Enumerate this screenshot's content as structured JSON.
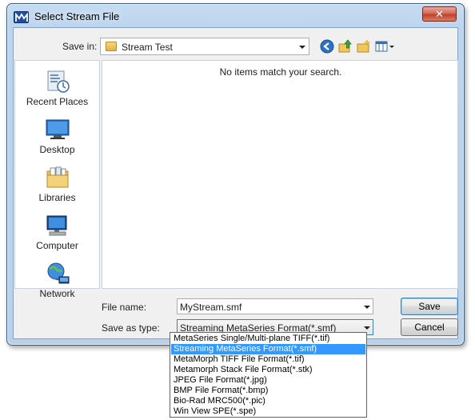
{
  "window": {
    "title": "Select Stream File",
    "close_glyph": "✕",
    "app_icon": "metamorph-app-icon"
  },
  "toolbar": {
    "save_in_label": "Save in:",
    "folder": "Stream Test",
    "icons": [
      "back-icon",
      "up-folder-icon",
      "new-folder-icon",
      "view-menu-icon"
    ]
  },
  "places": [
    {
      "label": "Recent Places",
      "icon": "recent-places-icon"
    },
    {
      "label": "Desktop",
      "icon": "desktop-icon"
    },
    {
      "label": "Libraries",
      "icon": "libraries-icon"
    },
    {
      "label": "Computer",
      "icon": "computer-icon"
    },
    {
      "label": "Network",
      "icon": "network-icon"
    }
  ],
  "file_list": {
    "empty_message": "No items match your search."
  },
  "form": {
    "file_name_label": "File name:",
    "file_name_value": "MyStream.smf",
    "save_type_label": "Save as type:",
    "save_type_value": "Streaming MetaSeries Format(*.smf)"
  },
  "buttons": {
    "save": "Save",
    "cancel": "Cancel"
  },
  "file_types": {
    "selected_index": 1,
    "options": [
      "MetaSeries Single/Multi-plane TIFF(*.tif)",
      "Streaming MetaSeries Format(*.smf)",
      "MetaMorph TIFF File Format(*.tif)",
      "Metamorph Stack File Format(*.stk)",
      "JPEG File Format(*.jpg)",
      "BMP File Format(*.bmp)",
      "Bio-Rad MRC500(*.pic)",
      "Win View SPE(*.spe)"
    ]
  },
  "colors": {
    "selection": "#3399ff",
    "title_bar": "#bcd4ee",
    "close_button": "#c2412b"
  }
}
